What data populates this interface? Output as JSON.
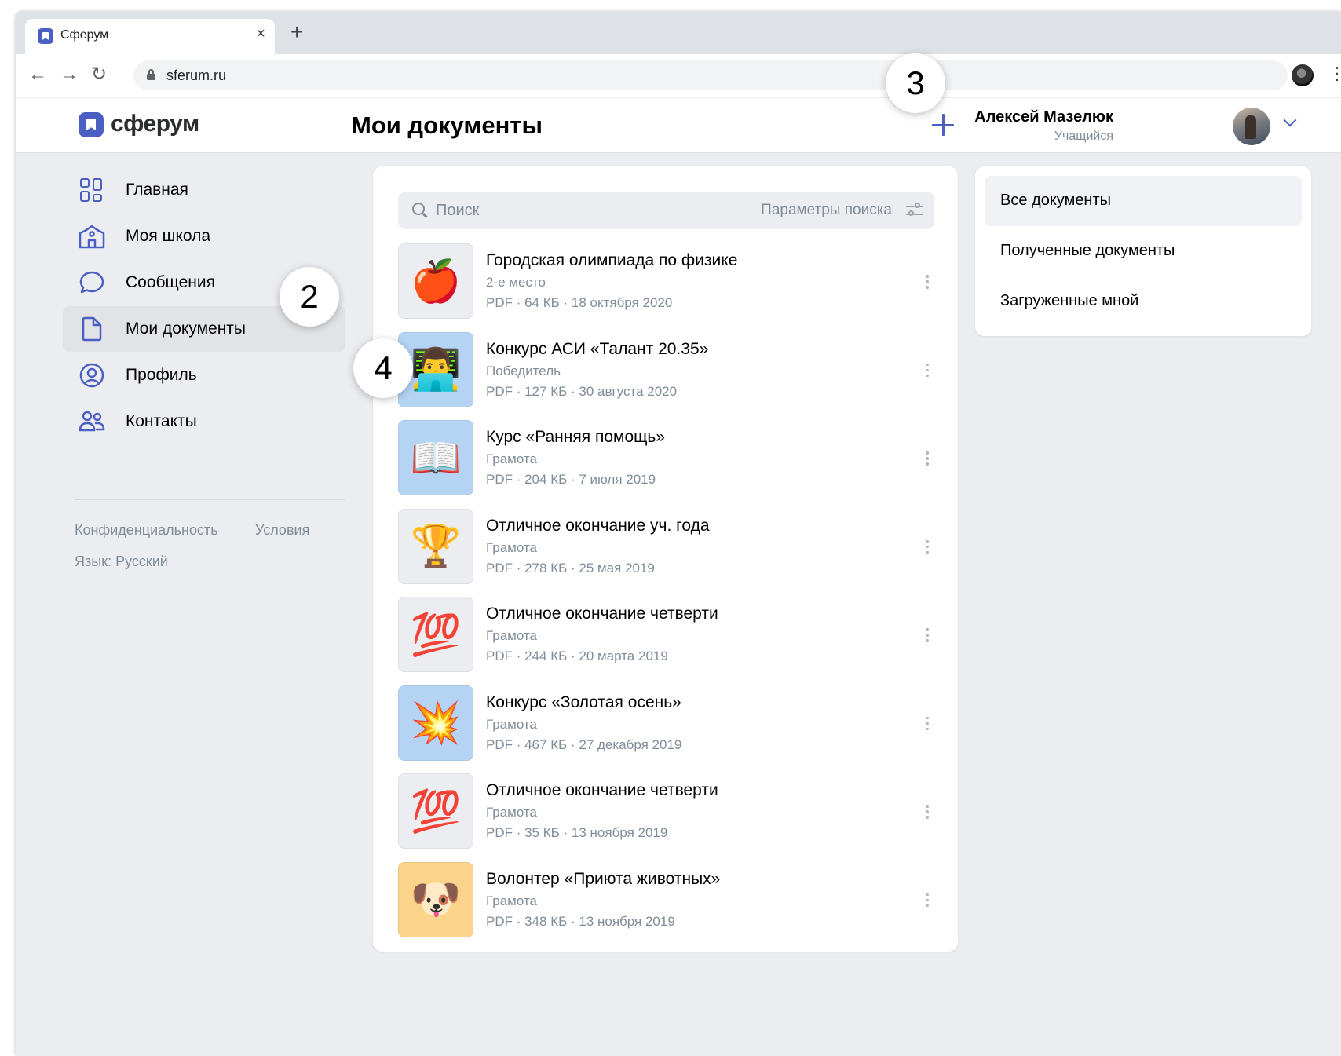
{
  "browser": {
    "tab_title": "Сферум",
    "tab_close": "×",
    "new_tab": "+",
    "back": "←",
    "forward": "→",
    "reload": "↻",
    "url": "sferum.ru",
    "menu": "⋮"
  },
  "header": {
    "logo": "сферум",
    "page_title": "Мои документы",
    "user_name": "Алексей Мазелюк",
    "user_role": "Учащийся"
  },
  "sidebar": {
    "items": [
      {
        "label": "Главная",
        "icon": "grid-icon"
      },
      {
        "label": "Моя школа",
        "icon": "school-icon"
      },
      {
        "label": "Сообщения",
        "icon": "message-icon"
      },
      {
        "label": "Мои документы",
        "icon": "document-icon",
        "active": true
      },
      {
        "label": "Профиль",
        "icon": "profile-icon"
      },
      {
        "label": "Контакты",
        "icon": "contacts-icon"
      }
    ],
    "footer": {
      "privacy": "Конфиденциальность",
      "terms": "Условия",
      "language": "Язык: Русский"
    }
  },
  "search": {
    "placeholder": "Поиск",
    "params": "Параметры поиска"
  },
  "documents": [
    {
      "title": "Городская олимпиада по физике",
      "subtitle": "2-е место",
      "meta": "PDF · 64 КБ · 18 октября 2020",
      "emoji": "🍎",
      "bg": "#ebedf0"
    },
    {
      "title": "Конкурс АСИ «Талант 20.35»",
      "subtitle": "Победитель",
      "meta": "PDF · 127 КБ · 30 августа 2020",
      "emoji": "👨‍💻",
      "bg": "#b5d4f4"
    },
    {
      "title": "Курс «Ранняя помощь»",
      "subtitle": "Грамота",
      "meta": "PDF · 204 КБ · 7 июля 2019",
      "emoji": "📖",
      "bg": "#b5d4f4"
    },
    {
      "title": "Отличное окончание уч. года",
      "subtitle": "Грамота",
      "meta": "PDF · 278 КБ · 25 мая 2019",
      "emoji": "🏆",
      "bg": "#ebedf0"
    },
    {
      "title": "Отличное окончание четверти",
      "subtitle": "Грамота",
      "meta": "PDF · 244 КБ · 20 марта 2019",
      "emoji": "💯",
      "bg": "#ebedf0"
    },
    {
      "title": "Конкурс «Золотая осень»",
      "subtitle": "Грамота",
      "meta": "PDF · 467 КБ · 27 декабря 2019",
      "emoji": "💥",
      "bg": "#b5d4f4"
    },
    {
      "title": "Отличное окончание четверти",
      "subtitle": "Грамота",
      "meta": "PDF · 35 КБ · 13 ноября 2019",
      "emoji": "💯",
      "bg": "#ebedf0"
    },
    {
      "title": "Волонтер «Приюта животных»",
      "subtitle": "Грамота",
      "meta": "PDF · 348 КБ · 13 ноября 2019",
      "emoji": "🐶",
      "bg": "#fbd38a"
    }
  ],
  "filters": [
    {
      "label": "Все документы",
      "active": true
    },
    {
      "label": "Полученные документы"
    },
    {
      "label": "Загруженные мной"
    }
  ],
  "callouts": [
    "2",
    "3",
    "4"
  ],
  "colors": {
    "accent": "#4a5fc1",
    "secondary_text": "#818c99",
    "page_bg": "#ebedf0"
  }
}
